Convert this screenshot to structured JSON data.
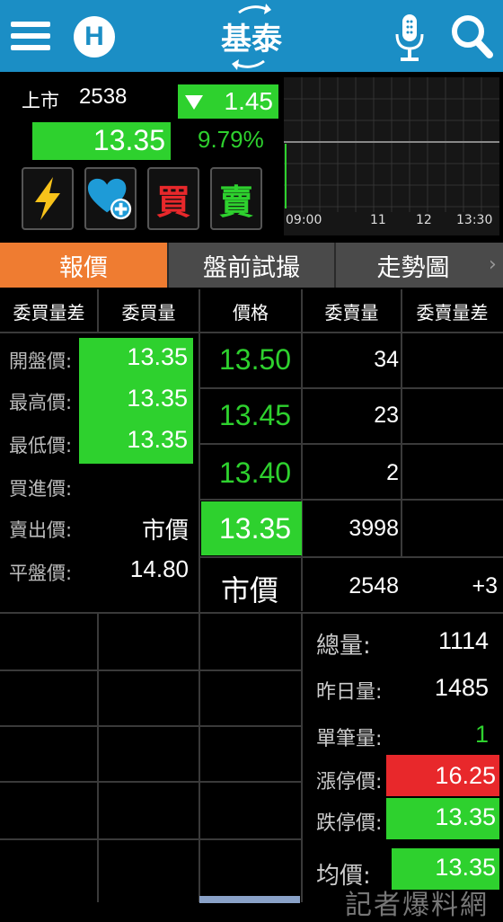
{
  "header": {
    "title": "基泰",
    "logo_letter": "H"
  },
  "quote": {
    "market": "上市",
    "code": "2538",
    "change": "1.45",
    "price": "13.35",
    "change_pct": "9.79%"
  },
  "actions": {
    "buy_label": "買",
    "sell_label": "賣"
  },
  "mini_chart": {
    "times": [
      "09:00",
      "11",
      "12",
      "13:30"
    ]
  },
  "tabs": [
    "報價",
    "盤前試撮",
    "走勢圖"
  ],
  "table": {
    "headers": [
      "委買量差",
      "委買量",
      "價格",
      "委賣量",
      "委賣量差"
    ],
    "left": [
      {
        "label": "開盤價:",
        "value": "13.35"
      },
      {
        "label": "最高價:",
        "value": "13.35"
      },
      {
        "label": "最低價:",
        "value": "13.35"
      },
      {
        "label": "買進價:",
        "value": ""
      },
      {
        "label": "賣出價:",
        "value": "市價"
      },
      {
        "label": "平盤價:",
        "value": "14.80"
      }
    ],
    "book": [
      {
        "price": "13.50",
        "vol": "34",
        "diff": ""
      },
      {
        "price": "13.45",
        "vol": "23",
        "diff": ""
      },
      {
        "price": "13.40",
        "vol": "2",
        "diff": ""
      },
      {
        "price": "13.35",
        "vol": "3998",
        "diff": ""
      },
      {
        "price": "市價",
        "vol": "2548",
        "diff": "+3"
      }
    ]
  },
  "stats": [
    {
      "label": "總量:",
      "value": "1114"
    },
    {
      "label": "昨日量:",
      "value": "1485"
    },
    {
      "label": "單筆量:",
      "value": "1"
    },
    {
      "label": "漲停價:",
      "value": "16.25"
    },
    {
      "label": "跌停價:",
      "value": "13.35"
    },
    {
      "label": "均價:",
      "value": "13.35"
    }
  ],
  "watermark": "記者爆料網",
  "colors": {
    "up": "#e8282b",
    "down": "#2ed12e",
    "accent": "#ef7c31",
    "brand": "#1b8ec5"
  }
}
